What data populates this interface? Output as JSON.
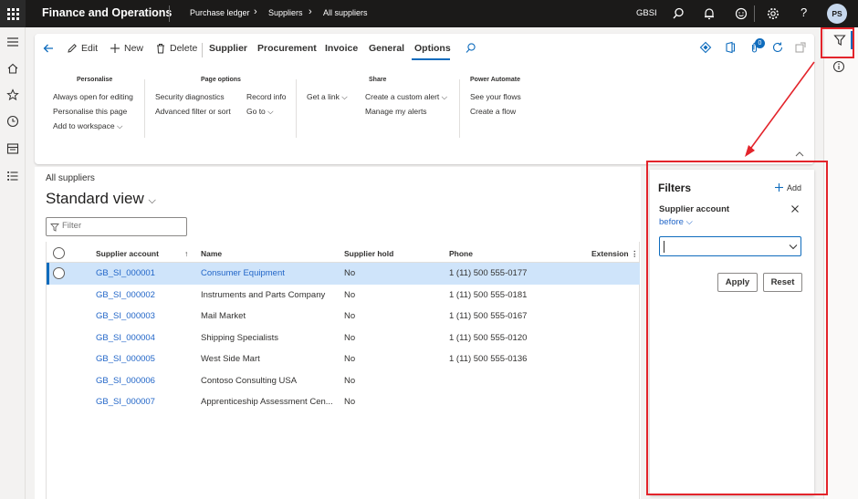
{
  "app": {
    "title": "Finance and Operations",
    "company": "GBSI",
    "user_initials": "PS"
  },
  "breadcrumb_nav": [
    "Purchase ledger",
    "Suppliers",
    "All suppliers"
  ],
  "toolbar": {
    "edit": "Edit",
    "new": "New",
    "delete": "Delete",
    "tabs": [
      "Supplier",
      "Procurement",
      "Invoice",
      "General",
      "Options"
    ],
    "active_tab": "Options",
    "badge_count": "0"
  },
  "groups": {
    "personalise": {
      "title": "Personalise",
      "items": [
        "Always open for editing",
        "Personalise this page",
        "Add to workspace"
      ]
    },
    "page_options": {
      "title": "Page options",
      "items": [
        "Security diagnostics",
        "Advanced filter or sort",
        "Record info",
        "Go to"
      ]
    },
    "share": {
      "title": "Share",
      "items": [
        "Get a link",
        "Create a custom alert",
        "Manage my alerts"
      ]
    },
    "power_automate": {
      "title": "Power Automate",
      "items": [
        "See your flows",
        "Create a flow"
      ]
    }
  },
  "page": {
    "breadcrumb": "All suppliers",
    "view_name": "Standard view",
    "filter_placeholder": "Filter"
  },
  "grid": {
    "columns": [
      "Supplier account",
      "Name",
      "Supplier hold",
      "Phone",
      "Extension"
    ],
    "rows": [
      {
        "account": "GB_SI_000001",
        "name": "Consumer Equipment",
        "hold": "No",
        "phone": "1 (11) 500 555-0177"
      },
      {
        "account": "GB_SI_000002",
        "name": "Instruments and Parts Company",
        "hold": "No",
        "phone": "1 (11) 500 555-0181"
      },
      {
        "account": "GB_SI_000003",
        "name": "Mail Market",
        "hold": "No",
        "phone": "1 (11) 500 555-0167"
      },
      {
        "account": "GB_SI_000004",
        "name": "Shipping Specialists",
        "hold": "No",
        "phone": "1 (11) 500 555-0120"
      },
      {
        "account": "GB_SI_000005",
        "name": "West Side Mart",
        "hold": "No",
        "phone": "1 (11) 500 555-0136"
      },
      {
        "account": "GB_SI_000006",
        "name": "Contoso Consulting USA",
        "hold": "No",
        "phone": ""
      },
      {
        "account": "GB_SI_000007",
        "name": "Apprenticeship Assessment Cen...",
        "hold": "No",
        "phone": ""
      }
    ]
  },
  "filters_pane": {
    "title": "Filters",
    "add": "Add",
    "field_label": "Supplier account",
    "operator": "before",
    "value": "",
    "apply": "Apply",
    "reset": "Reset"
  },
  "colors": {
    "accent": "#0f6cbd",
    "annotation": "#e3242b",
    "link": "#2266c8"
  }
}
